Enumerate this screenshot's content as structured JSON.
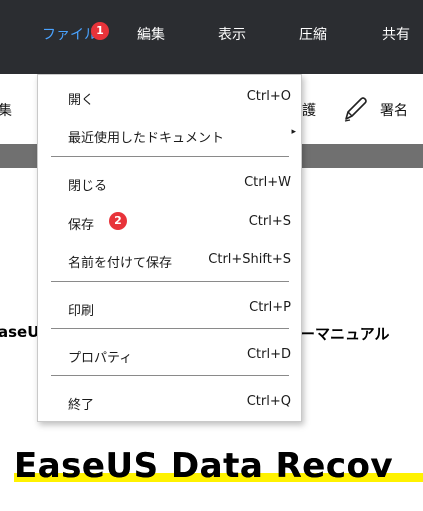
{
  "menubar": {
    "items": [
      {
        "label": "ファイル",
        "badge": "1"
      },
      {
        "label": "編集"
      },
      {
        "label": "表示"
      },
      {
        "label": "圧縮"
      },
      {
        "label": "共有"
      }
    ],
    "active_color": "#4aa3ff",
    "background": "#2b2d31"
  },
  "toolbar": {
    "left_fragment": "集",
    "right_fragment": "護",
    "sign_label": "署名",
    "sign_icon": "pen-icon"
  },
  "dropdown": {
    "items": [
      {
        "label": "開く",
        "shortcut": "Ctrl+O"
      },
      {
        "label": "最近使用したドキュメント",
        "submenu": "▸"
      },
      {
        "label": "閉じる",
        "shortcut": "Ctrl+W"
      },
      {
        "label": "保存",
        "shortcut": "Ctrl+S",
        "badge": "2"
      },
      {
        "label": "名前を付けて保存",
        "shortcut": "Ctrl+Shift+S"
      },
      {
        "label": "印刷",
        "shortcut": "Ctrl+P"
      },
      {
        "label": "プロパティ",
        "shortcut": "Ctrl+D"
      },
      {
        "label": "終了",
        "shortcut": "Ctrl+Q"
      }
    ]
  },
  "document": {
    "left_fragment": "aseU",
    "right_fragment": "ーマニュアル",
    "title": "EaseUS Data Recov",
    "highlight_color": "#fff200"
  },
  "badge_color": "#e8333a"
}
